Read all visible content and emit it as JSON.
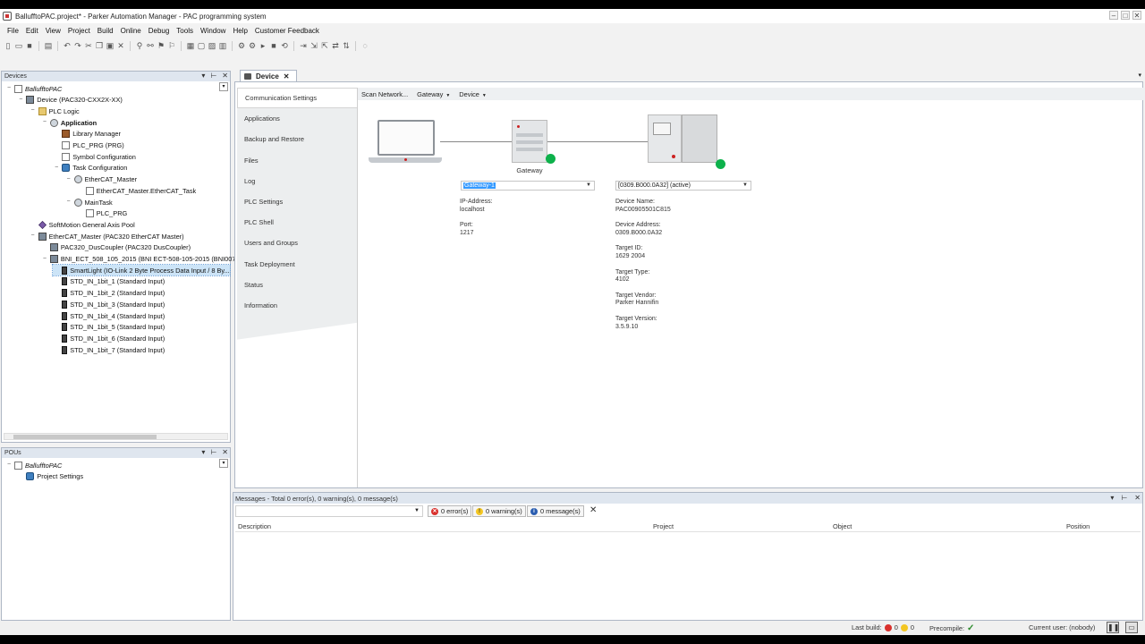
{
  "window": {
    "title": "BallufftoPAC.project* - Parker Automation Manager - PAC programming system",
    "controls": [
      "–",
      "□",
      "✕"
    ]
  },
  "menu": [
    "File",
    "Edit",
    "View",
    "Project",
    "Build",
    "Online",
    "Debug",
    "Tools",
    "Window",
    "Help",
    "Customer Feedback"
  ],
  "devices_panel": {
    "title": "Devices",
    "ctrls": [
      "▾",
      "⊢",
      "✕"
    ],
    "tree": [
      {
        "label": "BallufftoPAC",
        "depth": 0,
        "icon": "project-icon",
        "exp": "−",
        "italic": true
      },
      {
        "label": "Device (PAC320-CXX2X-XX)",
        "depth": 1,
        "icon": "device-icon",
        "exp": "−"
      },
      {
        "label": "PLC Logic",
        "depth": 2,
        "icon": "folder-icon",
        "exp": "−"
      },
      {
        "label": "Application",
        "depth": 3,
        "icon": "gear-icon",
        "exp": "−",
        "bold": true
      },
      {
        "label": "Library Manager",
        "depth": 4,
        "icon": "book-icon",
        "exp": ""
      },
      {
        "label": "PLC_PRG (PRG)",
        "depth": 4,
        "icon": "doc-icon",
        "exp": ""
      },
      {
        "label": "Symbol Configuration",
        "depth": 4,
        "icon": "doc-icon",
        "exp": ""
      },
      {
        "label": "Task Configuration",
        "depth": 4,
        "icon": "task-icon",
        "exp": "−"
      },
      {
        "label": "EtherCAT_Master",
        "depth": 5,
        "icon": "gear-icon",
        "exp": "−"
      },
      {
        "label": "EtherCAT_Master.EtherCAT_Task",
        "depth": 6,
        "icon": "doc-icon",
        "exp": ""
      },
      {
        "label": "MainTask",
        "depth": 5,
        "icon": "gear-icon",
        "exp": "−"
      },
      {
        "label": "PLC_PRG",
        "depth": 6,
        "icon": "doc-icon",
        "exp": ""
      },
      {
        "label": "SoftMotion General Axis Pool",
        "depth": 2,
        "icon": "axis-icon",
        "exp": ""
      },
      {
        "label": "EtherCAT_Master (PAC320 EtherCAT Master)",
        "depth": 2,
        "icon": "device-icon",
        "exp": "−"
      },
      {
        "label": "PAC320_DusCoupler (PAC320 DusCoupler)",
        "depth": 3,
        "icon": "device-icon",
        "exp": ""
      },
      {
        "label": "BNI_ECT_508_105_2015 (BNI ECT-508-105-2015 (BNI007",
        "depth": 3,
        "icon": "device-icon",
        "exp": "−"
      },
      {
        "label": "SmartLight (IO-Link 2 Byte Process Data Input / 8 By...",
        "depth": 4,
        "icon": "module-icon",
        "exp": "",
        "selected": true
      },
      {
        "label": "STD_IN_1bit_1 (Standard Input)",
        "depth": 4,
        "icon": "module-icon",
        "exp": ""
      },
      {
        "label": "STD_IN_1bit_2 (Standard Input)",
        "depth": 4,
        "icon": "module-icon",
        "exp": ""
      },
      {
        "label": "STD_IN_1bit_3 (Standard Input)",
        "depth": 4,
        "icon": "module-icon",
        "exp": ""
      },
      {
        "label": "STD_IN_1bit_4 (Standard Input)",
        "depth": 4,
        "icon": "module-icon",
        "exp": ""
      },
      {
        "label": "STD_IN_1bit_5 (Standard Input)",
        "depth": 4,
        "icon": "module-icon",
        "exp": ""
      },
      {
        "label": "STD_IN_1bit_6 (Standard Input)",
        "depth": 4,
        "icon": "module-icon",
        "exp": ""
      },
      {
        "label": "STD_IN_1bit_7 (Standard Input)",
        "depth": 4,
        "icon": "module-icon",
        "exp": ""
      }
    ]
  },
  "pous_panel": {
    "title": "POUs",
    "ctrls": [
      "▾",
      "⊢",
      "✕"
    ],
    "tree": [
      {
        "label": "BallufftoPAC",
        "depth": 0,
        "icon": "project-icon",
        "exp": "−",
        "italic": true
      },
      {
        "label": "Project Settings",
        "depth": 1,
        "icon": "settings-icon",
        "exp": ""
      }
    ]
  },
  "editor": {
    "tab_label": "Device",
    "tab_close": "✕",
    "side_tabs": [
      "Communication Settings",
      "Applications",
      "Backup and Restore",
      "Files",
      "Log",
      "PLC Settings",
      "PLC Shell",
      "Users and Groups",
      "Task Deployment",
      "Status",
      "Information"
    ],
    "active_side_tab": 0,
    "scan_network": "Scan Network...",
    "gateway_menu": "Gateway",
    "device_menu": "Device",
    "gateway_label": "Gateway",
    "gateway_combo": "Gateway-1",
    "device_combo": "[0309.B000.0A32] (active)",
    "gateway_info": {
      "ip_label": "IP-Address:",
      "ip": "localhost",
      "port_label": "Port:",
      "port": "1217"
    },
    "device_info": [
      {
        "label": "Device Name:",
        "value": "PAC00905501C815"
      },
      {
        "label": "Device Address:",
        "value": "0309.B000.0A32"
      },
      {
        "label": "Target ID:",
        "value": "1629 2004"
      },
      {
        "label": "Target Type:",
        "value": "4102"
      },
      {
        "label": "Target Vendor:",
        "value": "Parker Hannifin"
      },
      {
        "label": "Target Version:",
        "value": "3.5.9.10"
      }
    ],
    "status_color": "#0db14b"
  },
  "messages": {
    "header": "Messages - Total 0 error(s), 0 warning(s), 0 message(s)",
    "errors": "0 error(s)",
    "warnings": "0 warning(s)",
    "infos": "0 message(s)",
    "columns": [
      "Description",
      "Project",
      "Object",
      "Position"
    ]
  },
  "statusbar": {
    "last_build": "Last build:",
    "err_count": "0",
    "warn_count": "0",
    "precompile": "Precompile:",
    "current_user": "Current user: (nobody)"
  }
}
